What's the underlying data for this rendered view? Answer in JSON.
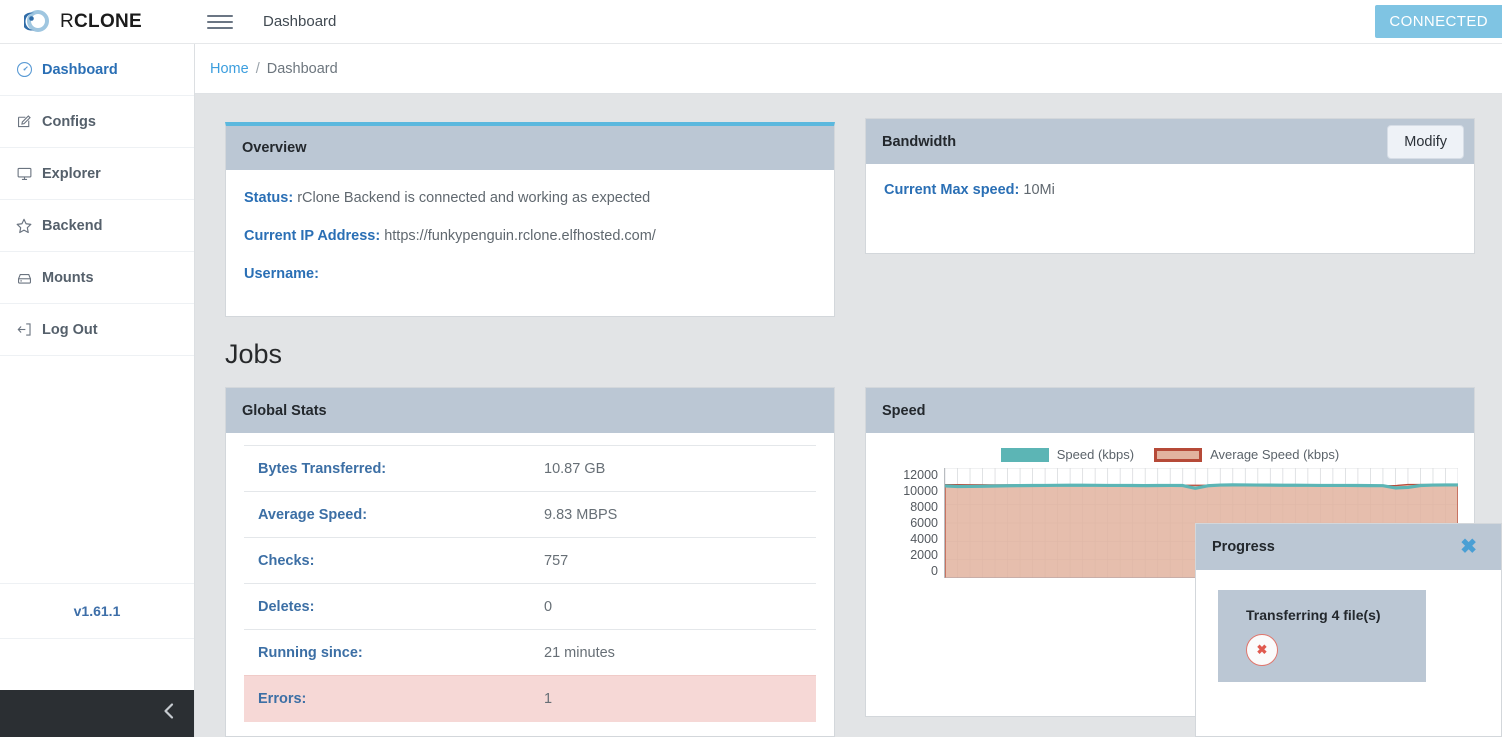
{
  "app": {
    "brand_r": "R",
    "brand_clone": "CLONE",
    "menu_icon": "hamburger-icon",
    "title": "Dashboard",
    "connection_status": "CONNECTED",
    "version": "v1.61.1",
    "accent": "#3c9ede",
    "header_bg": "#bbc7d4",
    "connected_bg": "#7fc4e3"
  },
  "sidebar": {
    "items": [
      {
        "label": "Dashboard",
        "icon": "gauge-icon",
        "active": true
      },
      {
        "label": "Configs",
        "icon": "edit-square-icon",
        "active": false
      },
      {
        "label": "Explorer",
        "icon": "monitor-icon",
        "active": false
      },
      {
        "label": "Backend",
        "icon": "star-icon",
        "active": false
      },
      {
        "label": "Mounts",
        "icon": "hard-drive-icon",
        "active": false
      },
      {
        "label": "Log Out",
        "icon": "logout-icon",
        "active": false
      }
    ],
    "collapse_icon": "chevron-left-icon"
  },
  "breadcrumb": {
    "home": "Home",
    "separator": "/",
    "current": "Dashboard"
  },
  "overview": {
    "title": "Overview",
    "status_label": "Status:",
    "status_value": "rClone Backend is connected and working as expected",
    "ip_label": "Current IP Address:",
    "ip_value": "https://funkypenguin.rclone.elfhosted.com/",
    "username_label": "Username:",
    "username_value": ""
  },
  "bandwidth": {
    "title": "Bandwidth",
    "modify_label": "Modify",
    "max_speed_label": "Current Max speed:",
    "max_speed_value": "10Mi"
  },
  "jobs": {
    "heading": "Jobs"
  },
  "global_stats": {
    "title": "Global Stats",
    "rows": [
      {
        "key": "Bytes Transferred:",
        "value": "10.87 GB",
        "error": false
      },
      {
        "key": "Average Speed:",
        "value": "9.83 MBPS",
        "error": false
      },
      {
        "key": "Checks:",
        "value": "757",
        "error": false
      },
      {
        "key": "Deletes:",
        "value": "0",
        "error": false
      },
      {
        "key": "Running since:",
        "value": "21 minutes",
        "error": false
      },
      {
        "key": "Errors:",
        "value": "1",
        "error": true
      }
    ]
  },
  "speed_card": {
    "title": "Speed"
  },
  "progress": {
    "title": "Progress",
    "close_icon": "close-icon",
    "transferring_text": "Transferring 4 file(s)",
    "cancel_icon": "cancel-icon"
  },
  "chart_data": {
    "type": "area",
    "title": "Speed",
    "xlabel": "",
    "ylabel": "",
    "ylim": [
      0,
      12000
    ],
    "yticks": [
      12000,
      10000,
      8000,
      6000,
      4000,
      2000,
      0
    ],
    "grid": true,
    "legend_position": "top-center",
    "series": [
      {
        "name": "Speed (kbps)",
        "color": "#5cb5b5",
        "values": [
          10050,
          9980,
          9990,
          10010,
          10040,
          10060,
          10080,
          10090,
          10100,
          10110,
          10120,
          10120,
          10110,
          10100,
          10100,
          10090,
          10080,
          10090,
          10100,
          10090,
          9790,
          10060,
          10140,
          10160,
          10150,
          10140,
          10130,
          10120,
          10120,
          10110,
          10100,
          10100,
          10100,
          10090,
          10080,
          10070,
          9820,
          9880,
          10090,
          10140,
          10150,
          10150
        ]
      },
      {
        "name": "Average Speed (kbps)",
        "color": "#e2b39f",
        "line_color": "#b64a38",
        "values": [
          10180,
          10180,
          10170,
          10170,
          10160,
          10160,
          10160,
          10150,
          10150,
          10150,
          10150,
          10140,
          10140,
          10140,
          10140,
          10130,
          10130,
          10130,
          10130,
          10120,
          10120,
          10120,
          10120,
          10110,
          10110,
          10110,
          10110,
          10100,
          10100,
          10100,
          10100,
          10090,
          10090,
          10090,
          10090,
          10080,
          10080,
          10200,
          10200,
          10190,
          10190,
          10190
        ]
      }
    ]
  }
}
